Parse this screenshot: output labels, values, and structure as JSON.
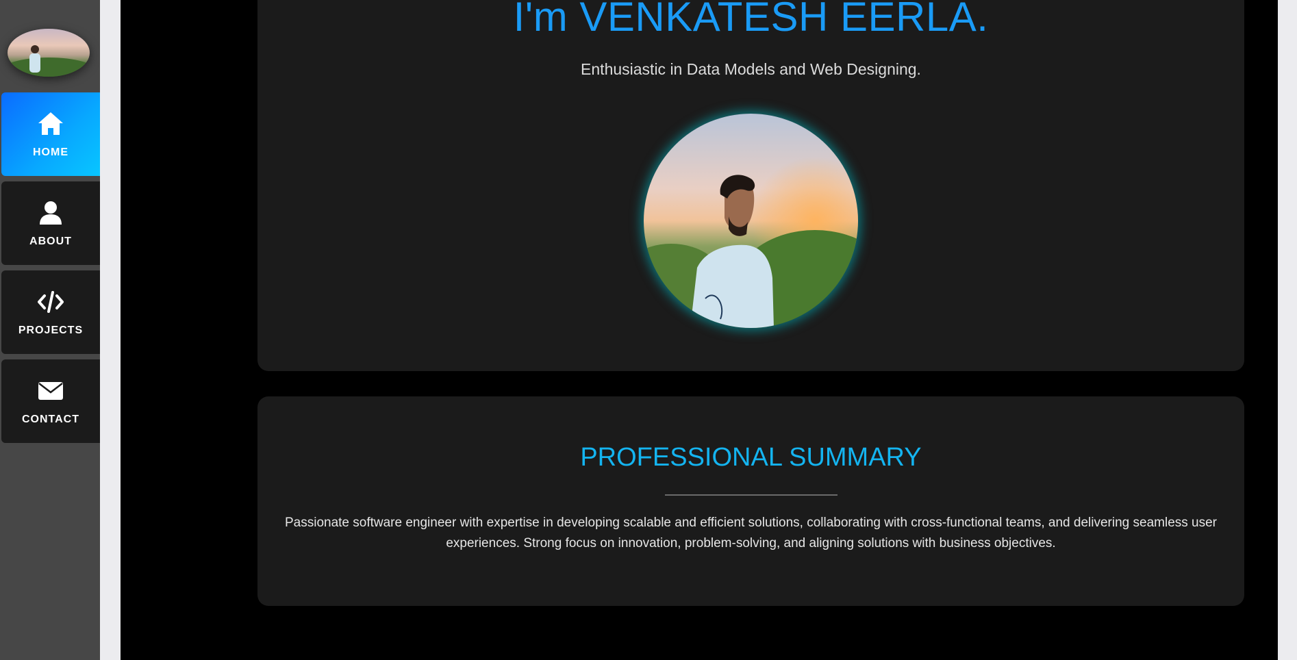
{
  "nav": {
    "items": [
      {
        "label": "HOME",
        "icon": "home-icon",
        "active": true
      },
      {
        "label": "ABOUT",
        "icon": "user-icon",
        "active": false
      },
      {
        "label": "PROJECTS",
        "icon": "code-icon",
        "active": false
      },
      {
        "label": "CONTACT",
        "icon": "envelope-icon",
        "active": false
      }
    ]
  },
  "hero": {
    "title": "I'm VENKATESH EERLA.",
    "subtitle": "Enthusiastic in Data Models and Web Designing."
  },
  "summary": {
    "title": "PROFESSIONAL SUMMARY",
    "text": "Passionate software engineer with expertise in developing scalable and efficient solutions, collaborating with cross-functional teams, and delivering seamless user experiences. Strong focus on innovation, problem-solving, and aligning solutions with business objectives."
  },
  "colors": {
    "accent": "#1a9bf6",
    "active_nav": "#08a8ff",
    "card": "#1b1b1b",
    "sidebar": "#474747"
  }
}
